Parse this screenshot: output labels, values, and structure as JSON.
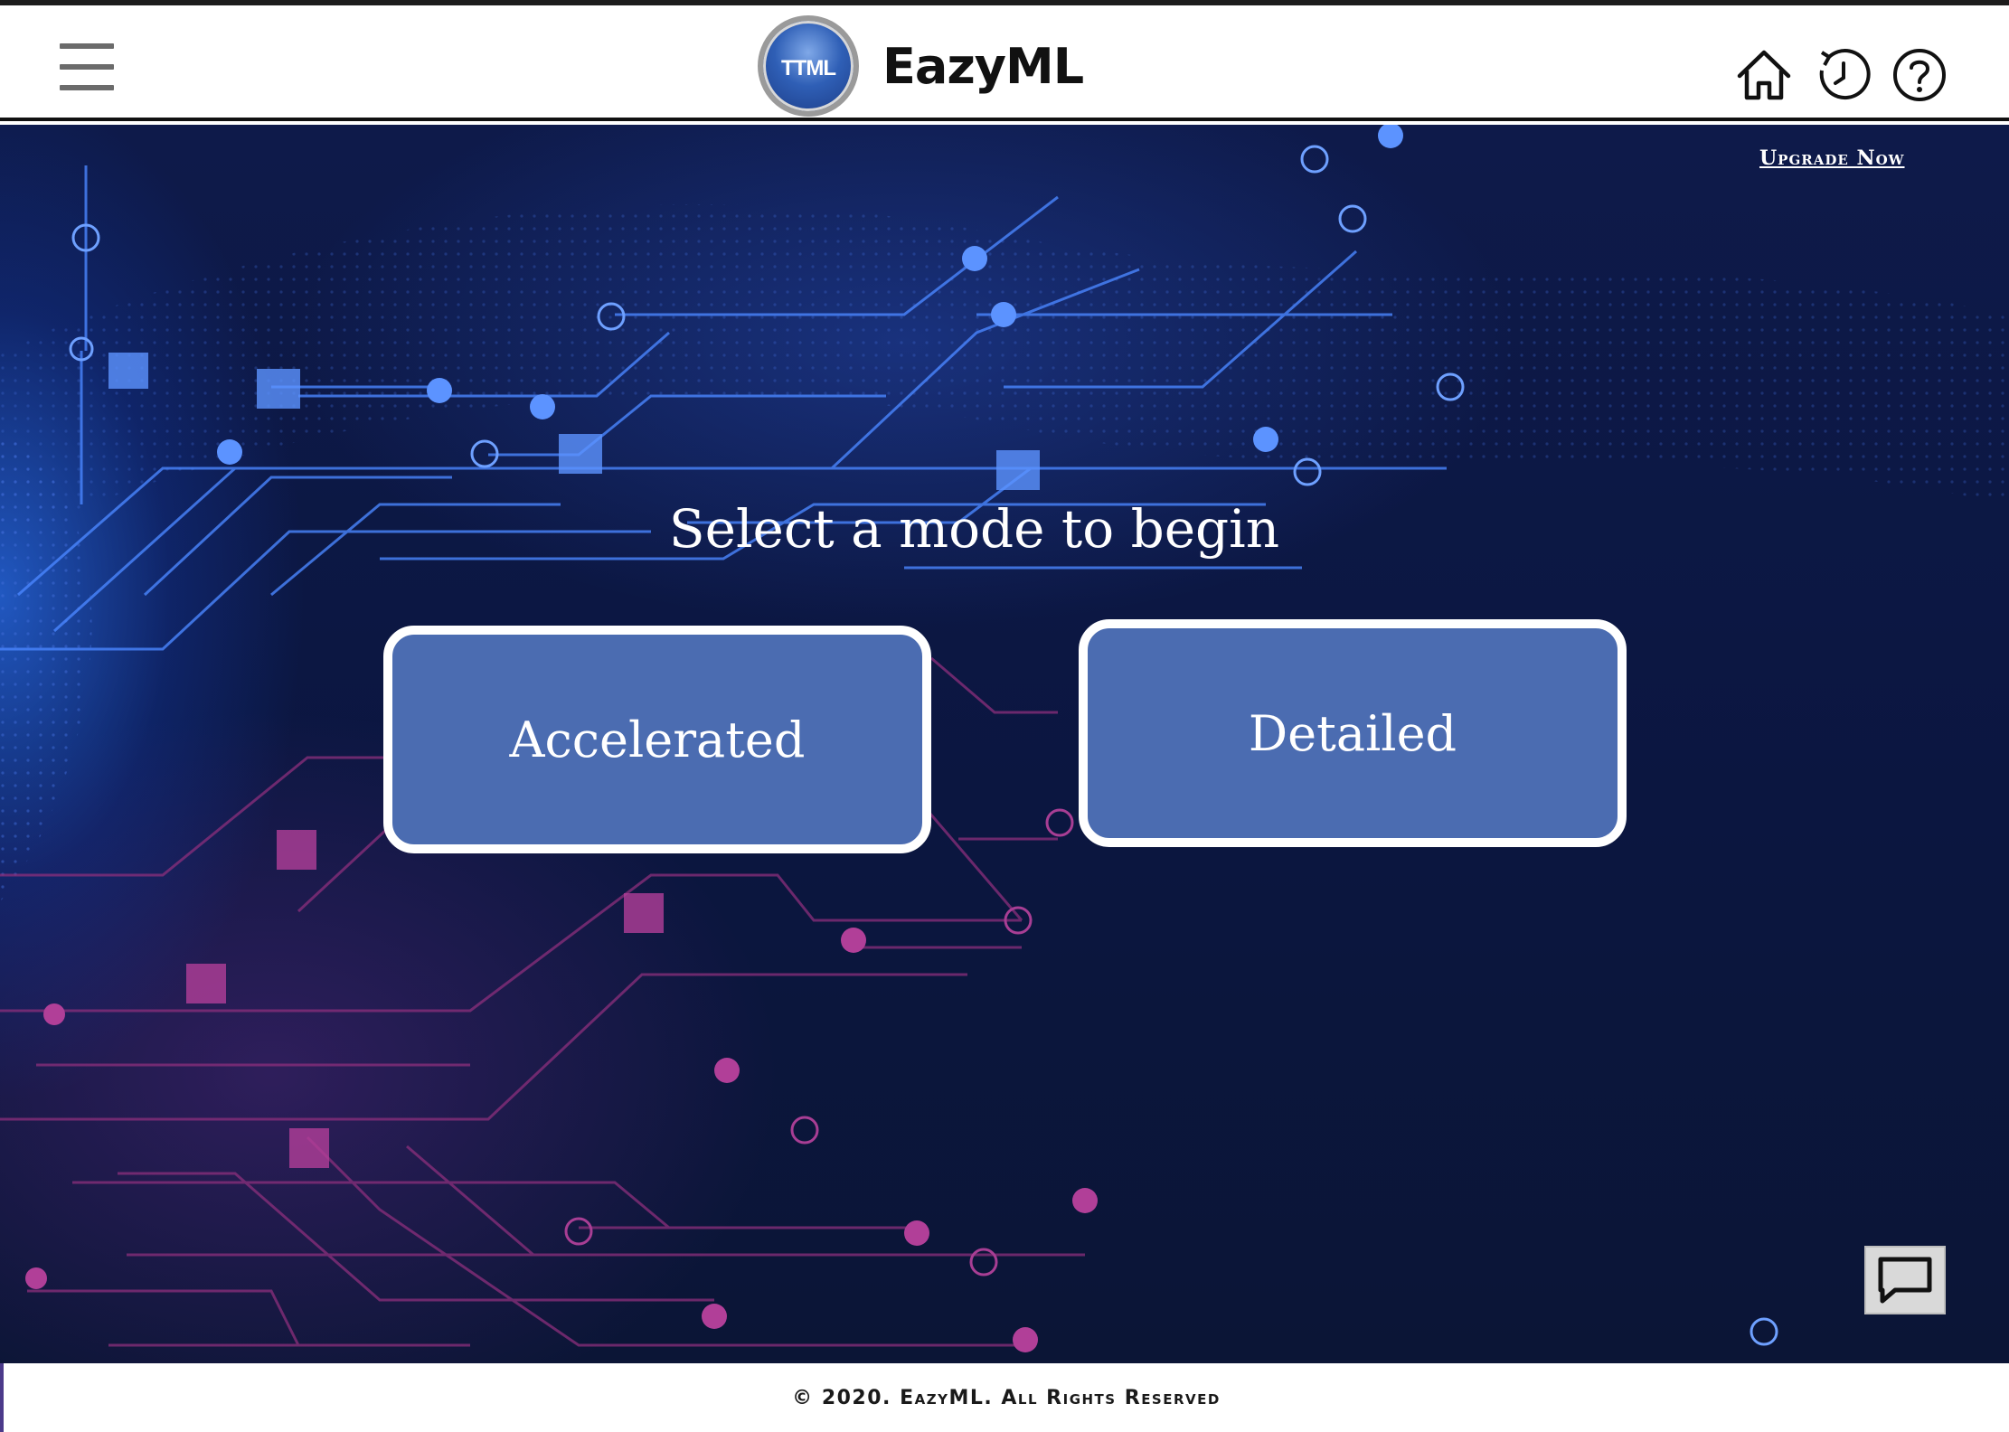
{
  "header": {
    "logo_text": "TTML",
    "app_title": "EazyML",
    "menu_icon": "hamburger-menu-icon",
    "home_icon": "home-icon",
    "history_icon": "history-icon",
    "help_icon": "help-icon"
  },
  "hero": {
    "upgrade_label": "Upgrade Now",
    "prompt": "Select a mode to begin",
    "modes": [
      {
        "label": "Accelerated"
      },
      {
        "label": "Detailed"
      }
    ],
    "chat_icon": "chat-icon"
  },
  "footer": {
    "text": "© 2020. EazyML. All Rights Reserved"
  },
  "colors": {
    "button_fill": "#4b6cb1",
    "button_border": "#ffffff",
    "background_dark": "#0b1640",
    "accent_blue": "#3d7dff",
    "accent_magenta": "#a0357e"
  }
}
